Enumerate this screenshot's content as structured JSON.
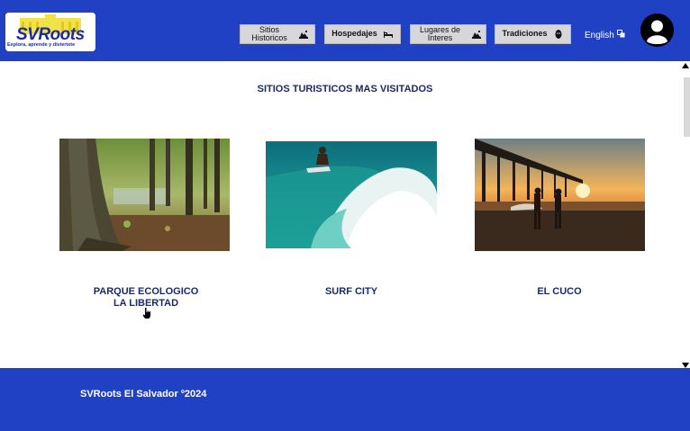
{
  "header": {
    "logo": {
      "name": "SVRoots",
      "tagline": "Explora, aprende y diviertete"
    },
    "nav": [
      {
        "label": "Sitios Historicos",
        "icon": "monument-icon"
      },
      {
        "label": "Hospedajes",
        "icon": "bed-icon"
      },
      {
        "label": "Lugares de Interes",
        "icon": "monument-icon"
      },
      {
        "label": "Tradiciones",
        "icon": "mask-icon"
      }
    ],
    "language": "English",
    "language_icon": "translate-icon",
    "avatar_icon": "user-avatar-icon"
  },
  "main": {
    "title": "SITIOS TURISTICOS MAS VISITADOS",
    "cards": [
      {
        "label_line1": "PARQUE ECOLOGICO",
        "label_line2": "LA LIBERTAD",
        "image": "forest-tree-photo"
      },
      {
        "label_line1": "SURF CITY",
        "label_line2": "",
        "image": "surfer-wave-photo"
      },
      {
        "label_line1": "EL CUCO",
        "label_line2": "",
        "image": "pier-sunset-photo"
      }
    ]
  },
  "footer": {
    "text": "SVRoots El Salvador º2024"
  },
  "colors": {
    "brand_blue": "#2141c4",
    "title_navy": "#1a2a6b",
    "nav_button_bg": "#d7d7d9"
  }
}
